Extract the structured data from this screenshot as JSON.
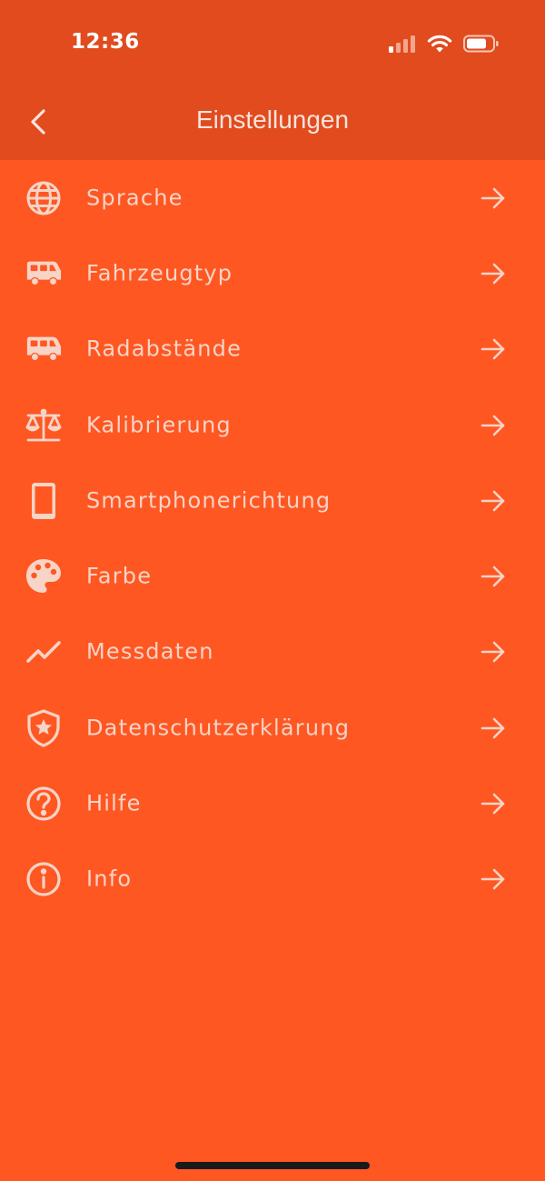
{
  "status_bar": {
    "time": "12:36"
  },
  "nav": {
    "title": "Einstellungen"
  },
  "colors": {
    "background": "#FF5722",
    "topbar": "#E14B1E",
    "text": "#F6D4C7"
  },
  "menu": {
    "items": [
      {
        "label": "Sprache",
        "icon": "globe-icon"
      },
      {
        "label": "Fahrzeugtyp",
        "icon": "van-icon"
      },
      {
        "label": "Radabstände",
        "icon": "van-icon"
      },
      {
        "label": "Kalibrierung",
        "icon": "scale-icon"
      },
      {
        "label": "Smartphonerichtung",
        "icon": "smartphone-icon"
      },
      {
        "label": "Farbe",
        "icon": "palette-icon"
      },
      {
        "label": "Messdaten",
        "icon": "line-chart-icon"
      },
      {
        "label": "Datenschutzerklärung",
        "icon": "shield-star-icon"
      },
      {
        "label": "Hilfe",
        "icon": "help-circle-icon"
      },
      {
        "label": "Info",
        "icon": "info-circle-icon"
      }
    ]
  }
}
